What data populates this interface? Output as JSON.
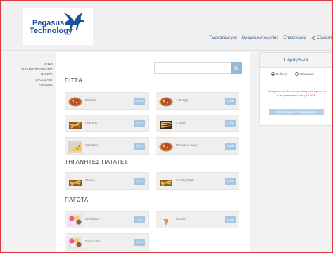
{
  "logo": {
    "line1": "Pegasus",
    "line2": "Technology"
  },
  "nav": [
    {
      "label": "Τιμοκατάλογος"
    },
    {
      "label": "Ωράριο Λειτουργίας"
    },
    {
      "label": "Επικοινωνία"
    },
    {
      "label": "Σύνδεση"
    }
  ],
  "sidebar": [
    "ΠΙΤΣΑ",
    "ΤΗΓΑΝΗΤΕΣ ΠΑΤΑΤΕΣ",
    "ΠΑΓΩΤΑ",
    "CROISSANT",
    "ΚΑΦΕΔΕΣ"
  ],
  "search": {
    "placeholder": ""
  },
  "sections": [
    {
      "title": "ΠΙΤΣΑ"
    },
    {
      "title": "ΤΗΓΑΝΗΤΕΣ ΠΑΤΑΤΕΣ"
    },
    {
      "title": "ΠΑΓΩΤΑ"
    }
  ],
  "products": [
    {
      "name": "Σπέσιαλ",
      "price": "13,50 €",
      "thumb": "pizza"
    },
    {
      "name": "4 Εποχές",
      "price": "8,50 €",
      "thumb": "pizza"
    },
    {
      "name": "Αγάπισες",
      "price": "9,00 €",
      "thumb": "fries"
    },
    {
      "name": "4 Τυριά",
      "price": "9,00 €",
      "thumb": "fries2"
    },
    {
      "name": "Καλαπόκι",
      "price": "8,50 €",
      "thumb": "slice"
    },
    {
      "name": "Μπέικον & αυγά",
      "price": "9,00 €",
      "thumb": "pizza"
    },
    {
      "name": "Classic",
      "price": "3,50 €",
      "thumb": "fries"
    },
    {
      "name": "Country Style",
      "price": "3,50 €",
      "thumb": "fries"
    },
    {
      "name": "Κυπελάκια",
      "price": "3,50 €",
      "thumb": "icecups"
    },
    {
      "name": "Χωνάκι",
      "price": "3,00 €",
      "thumb": "cone"
    },
    {
      "name": "Για το σπίτι",
      "price": "8,50 €",
      "thumb": "icecups"
    }
  ],
  "order": {
    "title": "Παραγγελία",
    "delivery": "Delivery",
    "takeaway": "Takeaway",
    "message": "Το ελάχιστο σύνολο για την παραγγελία πρέπει να είναι μεγαλύτερο ή ίσο με 4.00 €",
    "button": "Ολοκλήρωση Παραγγελίας"
  },
  "colors": {
    "accent": "#a6c7e3",
    "brand": "#1f4f96",
    "warning": "#d9343a",
    "frame": "#d63a3a"
  }
}
